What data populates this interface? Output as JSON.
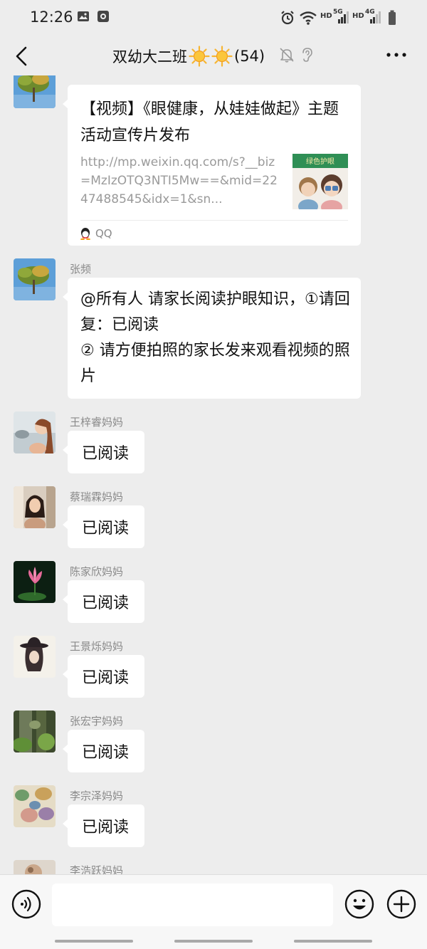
{
  "status_bar": {
    "time": "12:26",
    "net_1": "HD",
    "gen_1": "5G",
    "net_2": "HD",
    "gen_2": "4G",
    "icons": [
      "image-icon",
      "record-icon",
      "alarm-icon",
      "wifi-icon",
      "signal-icon",
      "battery-icon"
    ]
  },
  "nav": {
    "title": "双幼大二班",
    "member_count": "(54)",
    "icons": [
      "back-icon",
      "sun-icon",
      "mute-icon",
      "ear-icon",
      "more-icon"
    ]
  },
  "messages": [
    {
      "type": "link-card",
      "card": {
        "title": "【视频】《眼健康，从娃娃做起》主题活动宣传片发布",
        "desc": "http://mp.weixin.qq.com/s?__biz=MzIzOTQ3NTI5Mw==&mid=2247488545&idx=1&sn...",
        "source": "QQ",
        "thumb_caption": "绿色护眼"
      }
    },
    {
      "type": "text",
      "sender": "张频",
      "lines": [
        "@所有人 请家长阅读护眼知识，①请回复：已阅读",
        "② 请方便拍照的家长发来观看视频的照片"
      ]
    },
    {
      "type": "reply",
      "sender": "王梓睿妈妈",
      "text": "已阅读"
    },
    {
      "type": "reply",
      "sender": "蔡瑞霖妈妈",
      "text": "已阅读"
    },
    {
      "type": "reply",
      "sender": "陈家欣妈妈",
      "text": "已阅读"
    },
    {
      "type": "reply",
      "sender": "王景烁妈妈",
      "text": "已阅读"
    },
    {
      "type": "reply",
      "sender": "张宏宇妈妈",
      "text": "已阅读"
    },
    {
      "type": "reply",
      "sender": "李宗泽妈妈",
      "text": "已阅读"
    },
    {
      "type": "partial",
      "sender": "李浩跃妈妈"
    }
  ],
  "input_bar": {
    "placeholder": "",
    "icons": [
      "voice-icon",
      "emoji-icon",
      "plus-icon"
    ]
  },
  "colors": {
    "background": "#ededed",
    "bubble": "#ffffff",
    "sender_text": "#8a8a8a",
    "link_text": "#9a9a9a",
    "sun": "#f7b531"
  }
}
